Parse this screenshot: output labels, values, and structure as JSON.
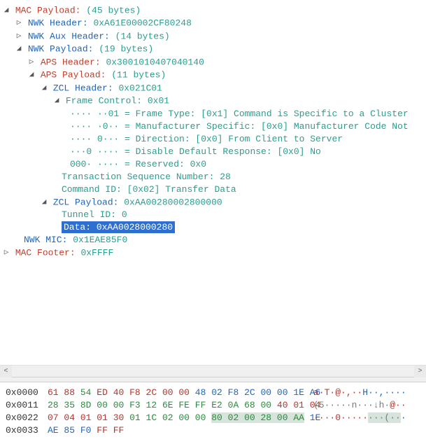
{
  "tree": {
    "mac_payload": {
      "label": "MAC Payload:",
      "value": "(45 bytes)"
    },
    "nwk_header": {
      "label": "NWK Header:",
      "value": "0xA61E00002CF80248"
    },
    "nwk_aux_header": {
      "label": "NWK Aux Header:",
      "value": "(14 bytes)"
    },
    "nwk_payload": {
      "label": "NWK Payload:",
      "value": "(19 bytes)"
    },
    "aps_header": {
      "label": "APS Header:",
      "value": "0x3001010407040140"
    },
    "aps_payload": {
      "label": "APS Payload:",
      "value": "(11 bytes)"
    },
    "zcl_header": {
      "label": "ZCL Header:",
      "value": "0x021C01"
    },
    "frame_control": {
      "label": "Frame Control:",
      "value": "0x01"
    },
    "fc_bits": {
      "b1": "···· ··01 = Frame Type: [0x1] Command is Specific to a Cluster",
      "b2": "···· ·0·· = Manufacturer Specific: [0x0] Manufacturer Code Not",
      "b3": "···· 0··· = Direction: [0x0] From Client to Server",
      "b4": "···0 ···· = Disable Default Response: [0x0] No",
      "b5": "000· ···· = Reserved: 0x0"
    },
    "ts_num": {
      "label": "Transaction Sequence Number:",
      "value": "28"
    },
    "cmd_id": {
      "label": "Command ID:",
      "value": "[0x02] Transfer Data"
    },
    "zcl_payload": {
      "label": "ZCL Payload:",
      "value": "0xAA00280002800000"
    },
    "tunnel_id": {
      "label": "Tunnel ID:",
      "value": "0"
    },
    "data": {
      "label": "Data:",
      "value": "0xAA0028000280"
    },
    "nwk_mic": {
      "label": "NWK MIC:",
      "value": "0x1EAE85F0"
    },
    "mac_footer": {
      "label": "MAC Footer:",
      "value": "0xFFFF"
    }
  },
  "hex": {
    "rows": [
      {
        "offset": "0x0000",
        "bytes": [
          {
            "t": "61",
            "c": "r"
          },
          {
            "t": "88",
            "c": "r"
          },
          {
            "t": "54",
            "c": "g"
          },
          {
            "t": "ED",
            "c": "r"
          },
          {
            "t": "40",
            "c": "r"
          },
          {
            "t": "F8",
            "c": "r"
          },
          {
            "t": "2C",
            "c": "r"
          },
          {
            "t": "00",
            "c": "r"
          },
          {
            "t": "00",
            "c": "r"
          },
          {
            "t": "48",
            "c": "b"
          },
          {
            "t": "02",
            "c": "b"
          },
          {
            "t": "F8",
            "c": "b"
          },
          {
            "t": "2C",
            "c": "b"
          },
          {
            "t": "00",
            "c": "b"
          },
          {
            "t": "00",
            "c": "b"
          },
          {
            "t": "1E",
            "c": "b"
          },
          {
            "t": "A6",
            "c": "b"
          }
        ],
        "ascii": [
          {
            "t": "a·T·",
            "c": "r"
          },
          {
            "t": "@·,··",
            "c": "r"
          },
          {
            "t": "H··,····",
            "c": "b"
          }
        ]
      },
      {
        "offset": "0x0011",
        "bytes": [
          {
            "t": "28",
            "c": "g"
          },
          {
            "t": "35",
            "c": "g"
          },
          {
            "t": "8D",
            "c": "g"
          },
          {
            "t": "00",
            "c": "g"
          },
          {
            "t": "00",
            "c": "g"
          },
          {
            "t": "F3",
            "c": "g"
          },
          {
            "t": "12",
            "c": "g"
          },
          {
            "t": "6E",
            "c": "g"
          },
          {
            "t": "FE",
            "c": "g"
          },
          {
            "t": "FF",
            "c": "g"
          },
          {
            "t": "E2",
            "c": "g"
          },
          {
            "t": "0A",
            "c": "g"
          },
          {
            "t": "68",
            "c": "g"
          },
          {
            "t": "00",
            "c": "g"
          },
          {
            "t": "40",
            "c": "r"
          },
          {
            "t": "01",
            "c": "r"
          },
          {
            "t": "04",
            "c": "r"
          }
        ],
        "ascii": [
          {
            "t": "(5·····n···↓h·",
            "c": "gr"
          },
          {
            "t": "@··",
            "c": "r"
          }
        ]
      },
      {
        "offset": "0x0022",
        "bytes": [
          {
            "t": "07",
            "c": "r"
          },
          {
            "t": "04",
            "c": "r"
          },
          {
            "t": "01",
            "c": "r"
          },
          {
            "t": "01",
            "c": "r"
          },
          {
            "t": "30",
            "c": "r"
          },
          {
            "t": "01",
            "c": "g"
          },
          {
            "t": "1C",
            "c": "g"
          },
          {
            "t": "02",
            "c": "g"
          },
          {
            "t": "00",
            "c": "g"
          },
          {
            "t": "00",
            "c": "g"
          },
          {
            "t": "80",
            "c": "g",
            "h": 1
          },
          {
            "t": "02",
            "c": "g",
            "h": 1
          },
          {
            "t": "00",
            "c": "g",
            "h": 1
          },
          {
            "t": "28",
            "c": "g",
            "h": 1
          },
          {
            "t": "00",
            "c": "g",
            "h": 1
          },
          {
            "t": "AA",
            "c": "g",
            "h": 1
          },
          {
            "t": "1E",
            "c": "b"
          }
        ],
        "ascii": [
          {
            "t": "····0",
            "c": "r"
          },
          {
            "t": "·····",
            "c": "r"
          },
          {
            "t": "···(··",
            "c": "gr",
            "h": 1
          },
          {
            "t": "·",
            "c": "b"
          }
        ]
      },
      {
        "offset": "0x0033",
        "bytes": [
          {
            "t": "AE",
            "c": "b"
          },
          {
            "t": "85",
            "c": "b"
          },
          {
            "t": "F0",
            "c": "b"
          },
          {
            "t": "FF",
            "c": "r"
          },
          {
            "t": "FF",
            "c": "r"
          }
        ],
        "ascii": []
      }
    ]
  }
}
